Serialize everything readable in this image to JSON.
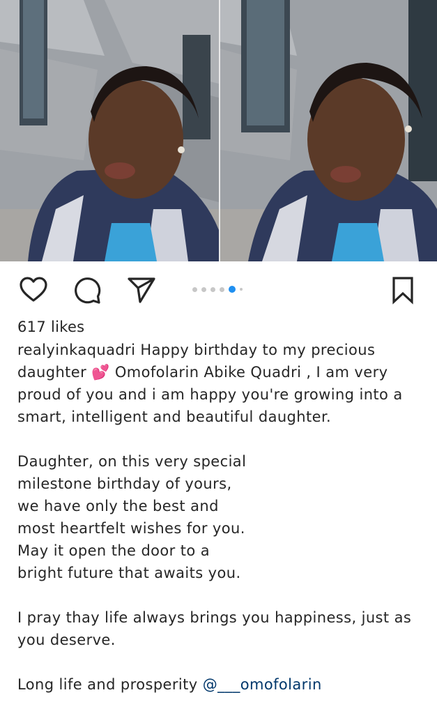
{
  "post": {
    "images": {
      "current_index": 5,
      "total": 6,
      "left_photo_icon": "selfie-photo",
      "right_photo_icon": "selfie-photo"
    },
    "actions": {
      "like_icon": "heart-outline-icon",
      "comment_icon": "speech-bubble-icon",
      "share_icon": "paper-plane-icon",
      "save_icon": "bookmark-outline-icon",
      "accent_color": "#1f8ff0"
    },
    "likes_text": "617 likes",
    "caption": {
      "username": "realyinkaquadri",
      "p1_line1_rest": " Happy birthday to my precious",
      "p1_line2_start": "daughter ",
      "p1_line2_emoji": "💕",
      "p1_line2_rest": " Omofolarin Abike Quadri , I am very",
      "p1_line3": "proud of you and i am happy you're growing into a",
      "p1_line4": "smart, intelligent and beautiful daughter.",
      "p2_lines": [
        "Daughter, on this very special",
        "milestone birthday of yours,",
        "we have only the best and",
        "most heartfelt wishes for you.",
        "May it open the door to a",
        "bright future that awaits you."
      ],
      "p3_line1": "I pray thay life always brings you happiness, just as",
      "p3_line2": "you deserve.",
      "p4_text": "Long life and prosperity ",
      "p4_mention": "@___omofolarin"
    }
  }
}
